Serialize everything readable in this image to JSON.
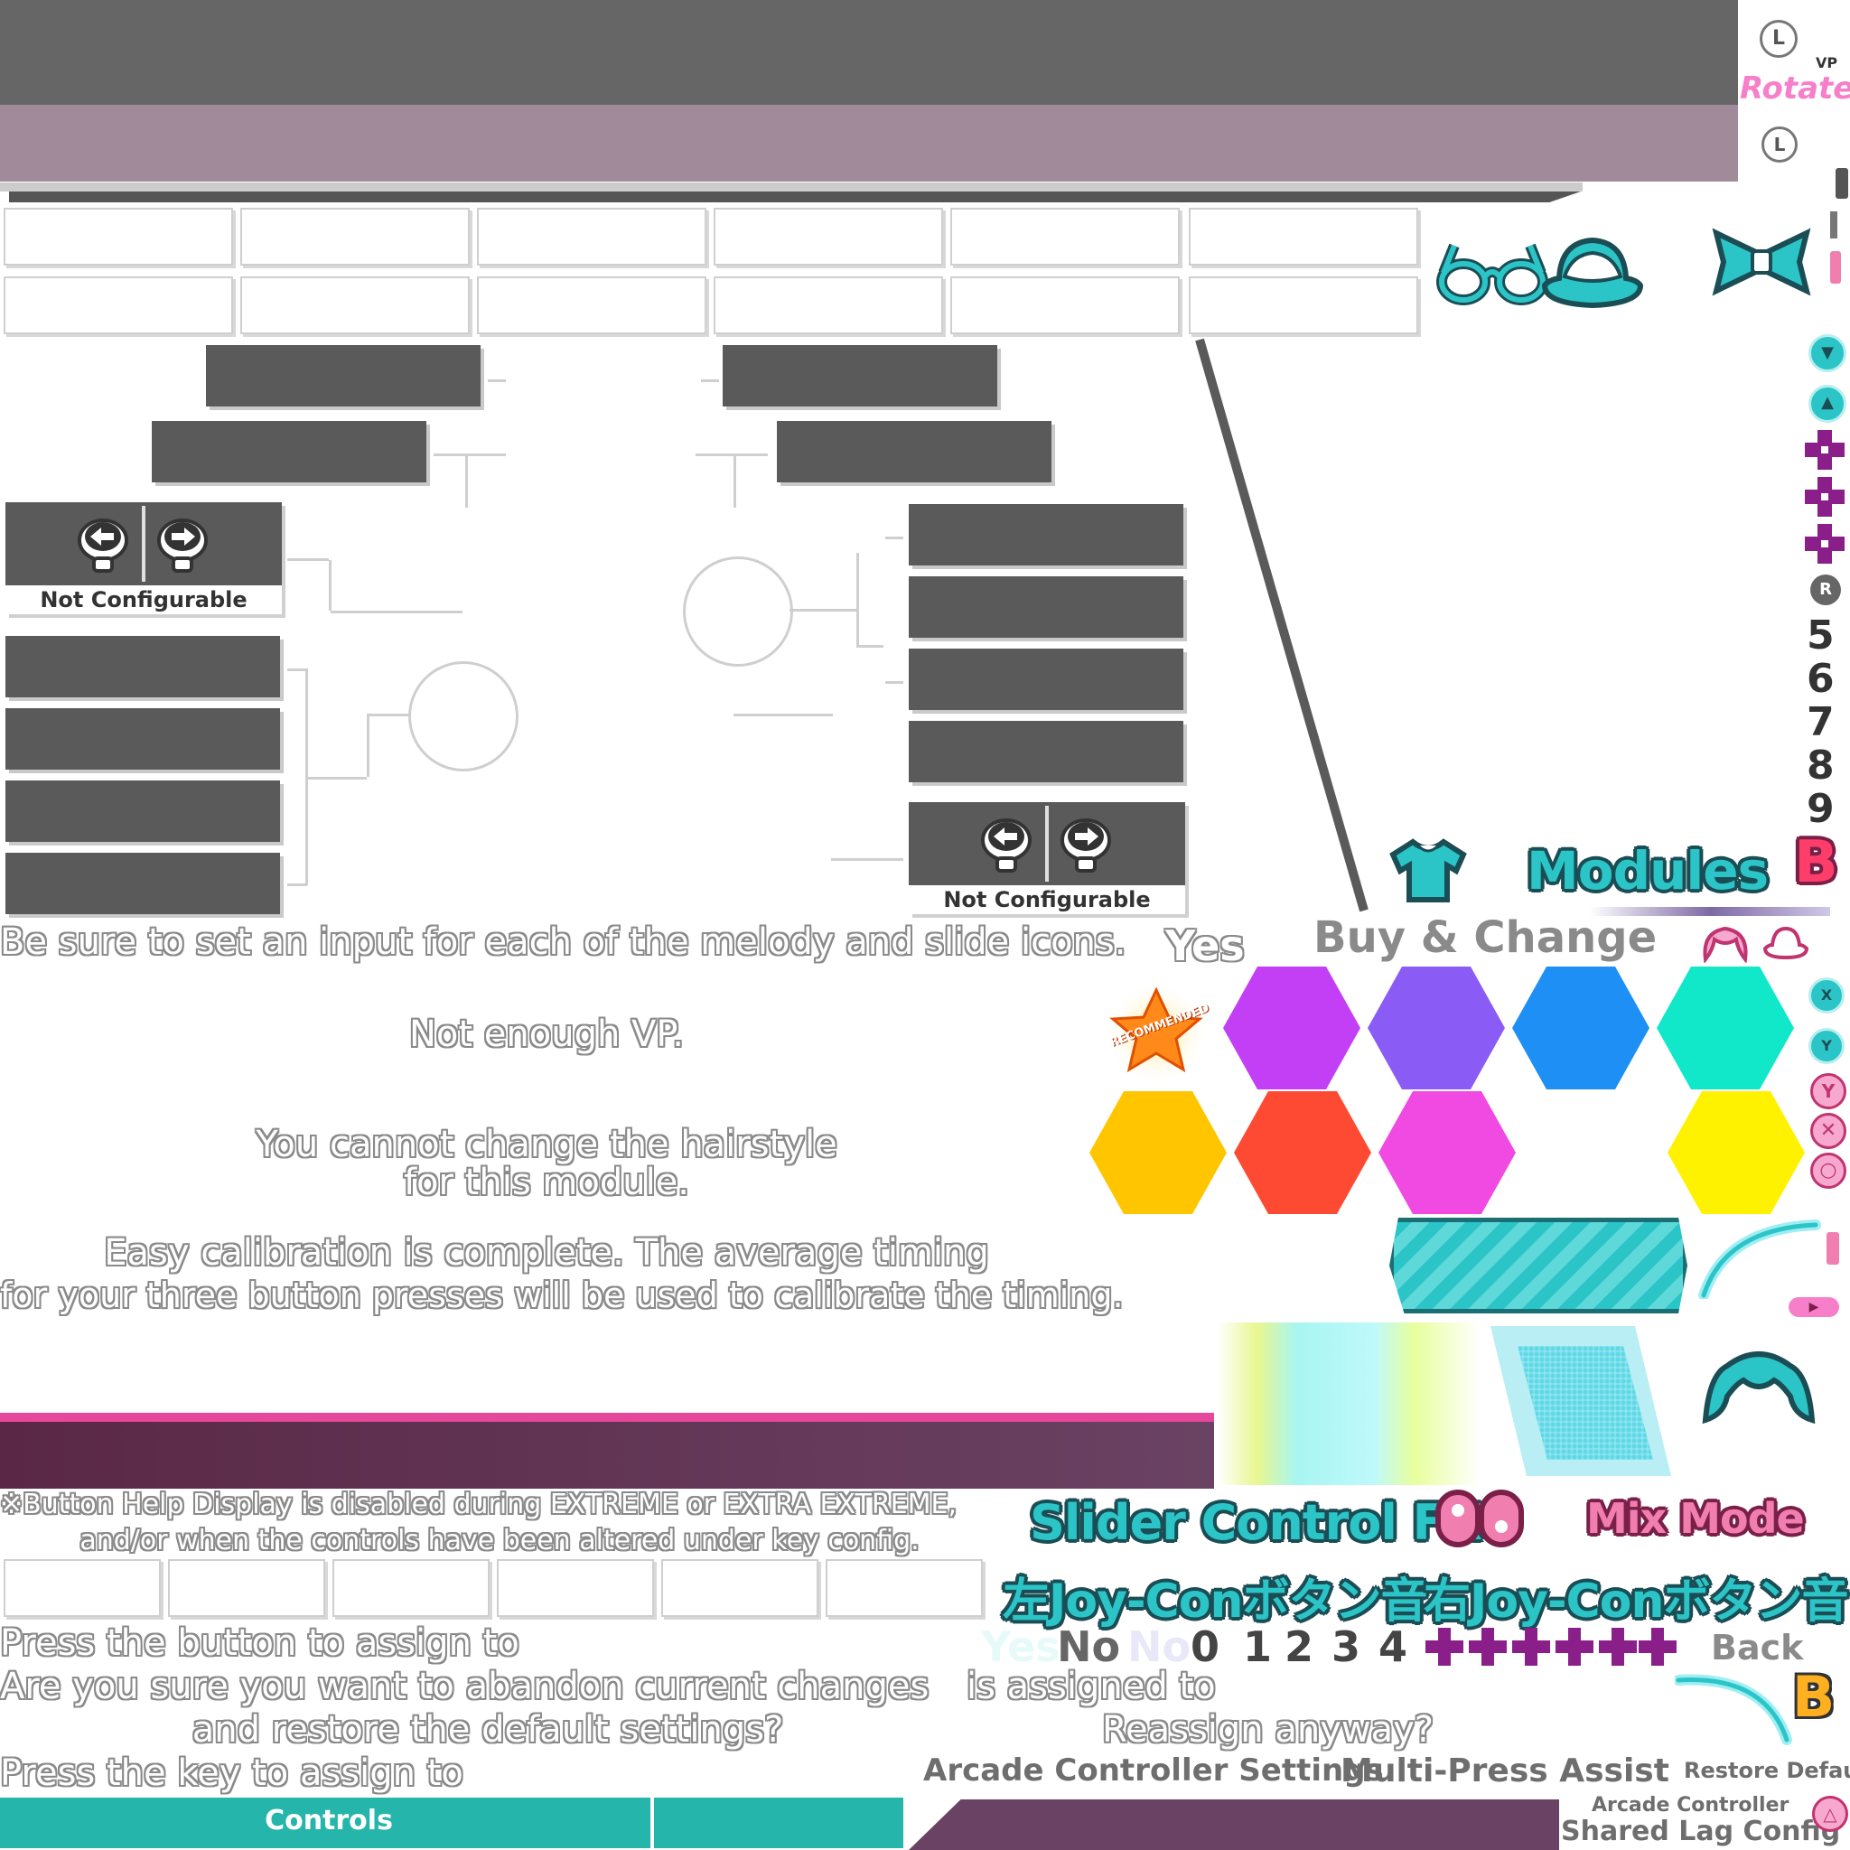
{
  "header": {
    "top_band_color": "#666666",
    "sub_band_color": "#a18b9b"
  },
  "top_right": {
    "rotate_label": "Rotate",
    "vp_label": "VP",
    "l_button": "L"
  },
  "key_config_panels": {
    "not_configurable_label": "Not Configurable"
  },
  "messages": {
    "melody_slide": "Be sure to set an input for each of the melody and slide icons.",
    "yes_label": "Yes",
    "not_enough_vp": "Not enough VP.",
    "hairstyle_line1": "You cannot change the hairstyle",
    "hairstyle_line2": "for this module.",
    "calibration_line1": "Easy calibration is complete. The average timing",
    "calibration_line2": "for your three button presses will be used to calibrate the timing.",
    "button_help_line1": "※Button Help Display is disabled during EXTREME or EXTRA EXTREME,",
    "button_help_line2": "and/or when the controls have been altered under key config.",
    "press_button": "Press the button to assign to",
    "abandon_line1": "Are you sure you want to abandon current changes",
    "abandon_line2": "and restore the default settings?",
    "assigned_to": "is assigned to",
    "reassign": "Reassign anyway?",
    "press_key": "Press the key to assign to"
  },
  "shop": {
    "modules_title": "Modules",
    "buy_change": "Buy & Change",
    "recommended_badge": "RECOMMENDED",
    "b_letter": "B",
    "hex_colors_row1": [
      "#c23ff5",
      "#8a5cf5",
      "#1d8ff5",
      "#10e8c9"
    ],
    "hex_colors_row2": [
      "#ffc600",
      "#ff4a33",
      "#f04ae3",
      "#fff200"
    ]
  },
  "button_icons": {
    "x": "X",
    "y": "Y",
    "r": "R",
    "digits_right": [
      "5",
      "6",
      "7",
      "8",
      "9"
    ],
    "digits_bottom": [
      "0",
      "1",
      "2",
      "3",
      "4"
    ]
  },
  "bottom": {
    "slider_fx": "Slider Control FX",
    "mix_mode": "Mix Mode",
    "left_joycon": "左Joy-Conボタン音",
    "right_joycon": "右Joy-Conボタン音",
    "yes": "Yes",
    "no": "No",
    "back": "Back",
    "arcade_settings": "Arcade Controller Settings",
    "multi_press": "Multi-Press Assist",
    "restore_defaults": "Restore Defaults",
    "arcade_controller": "Arcade Controller",
    "shared_lag": "Shared Lag Config",
    "controls": "Controls"
  }
}
